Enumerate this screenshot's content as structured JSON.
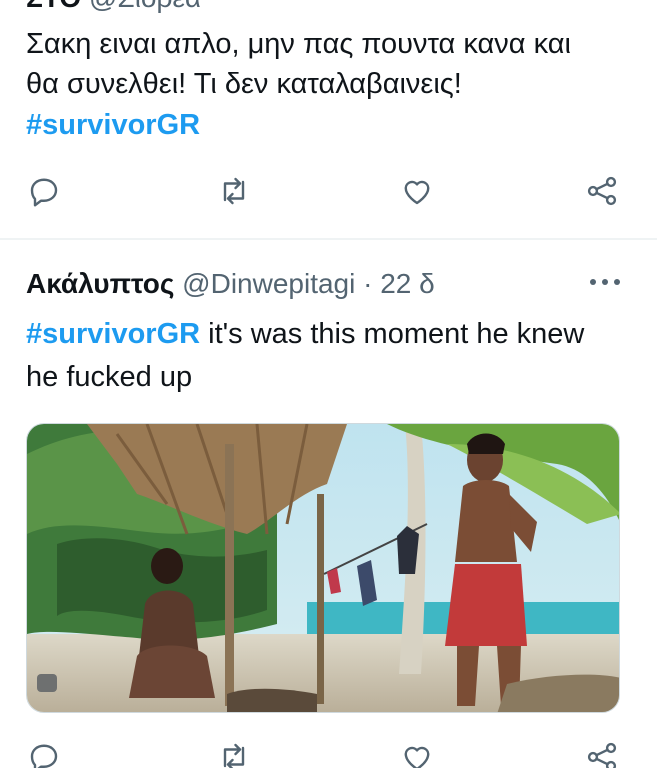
{
  "tweet1": {
    "header_fragment_name": "ΣΤΟ",
    "header_fragment_handle": "@Σιορεα",
    "line1": "Σακη ειναι απλο, μην πας πουντα κανα και",
    "line2": "θα συνελθει! Τι δεν καταλαβαινεις!",
    "hashtag": "#survivorGR",
    "actions": [
      "reply-icon",
      "retweet-icon",
      "like-icon",
      "share-icon"
    ]
  },
  "tweet2": {
    "name": "Ακάλυπτος",
    "handle": "@Dinwepitagi",
    "separator": "·",
    "time": "22 δ",
    "hashtag": "#survivorGR",
    "text_line1_rest": " it's was this moment he knew",
    "text_line2": "he fucked up",
    "more": "more-icon",
    "media": "photo of two contestants on a tropical beach",
    "actions": [
      "reply-icon",
      "retweet-icon",
      "like-icon",
      "share-icon"
    ]
  },
  "colors": {
    "text": "#0f1419",
    "secondary": "#536471",
    "hashtag": "#1d9bf0",
    "icon": "#536471",
    "divider": "#eff3f4"
  }
}
